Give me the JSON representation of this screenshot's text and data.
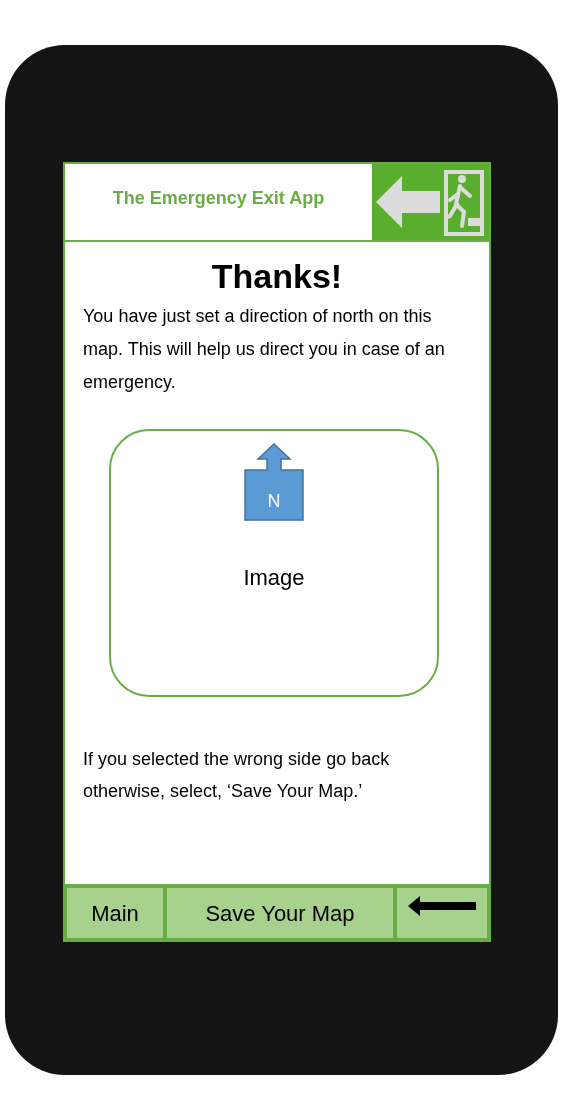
{
  "header": {
    "title": "The Emergency Exit App"
  },
  "heading": "Thanks!",
  "message": "You have just set a direction of north on this map. This will help us direct you in case of an emergency.",
  "image_placeholder": {
    "marker_label": "N",
    "label": "Image"
  },
  "hint": "If you selected the wrong side go back otherwise, select, ‘Save Your Map.’",
  "nav_buttons": [
    {
      "kind": "text",
      "label": "Main"
    },
    {
      "kind": "text",
      "label": "Save Your Map"
    },
    {
      "kind": "back"
    }
  ]
}
